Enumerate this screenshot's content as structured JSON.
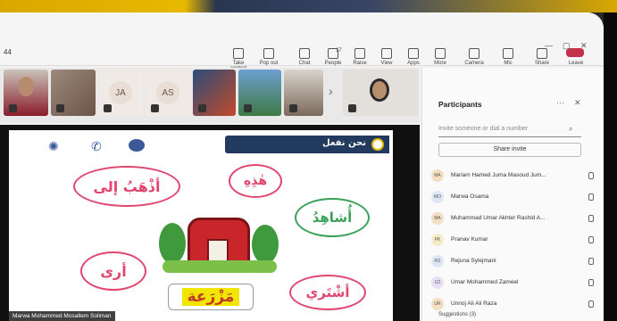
{
  "titlebar": {
    "left_text": "44",
    "buttons": [
      {
        "label": "Take control"
      },
      {
        "label": "Pop out"
      },
      {
        "label": "Chat"
      },
      {
        "label": "People",
        "count": "17"
      },
      {
        "label": "Raise"
      },
      {
        "label": "View"
      },
      {
        "label": "Apps"
      },
      {
        "label": "More"
      },
      {
        "label": "Camera"
      },
      {
        "label": "Mic"
      },
      {
        "label": "Share"
      },
      {
        "label": "Leave"
      }
    ]
  },
  "video_strip": {
    "tiles": [
      {
        "type": "video"
      },
      {
        "type": "video"
      },
      {
        "type": "initials",
        "initials": "JA"
      },
      {
        "type": "initials",
        "initials": "AS"
      },
      {
        "type": "video"
      },
      {
        "type": "video"
      },
      {
        "type": "video"
      },
      {
        "type": "video"
      }
    ],
    "next_glyph": "›"
  },
  "slide": {
    "header": "نحن نفعل",
    "words": [
      {
        "text": "أذْهَبُ إلى",
        "color": "#e0466f"
      },
      {
        "text": "هٰذِهِ",
        "color": "#e0466f"
      },
      {
        "text": "أُشاهِدُ",
        "color": "#3aa157"
      },
      {
        "text": "أرى",
        "color": "#e0466f"
      },
      {
        "text": "أشْتَري",
        "color": "#e0466f"
      },
      {
        "text": "مَزْرَعة",
        "color": "#f2e600"
      }
    ],
    "presenter": "Marwa Mohammed Mosallem Soliman"
  },
  "participants": {
    "title": "Participants",
    "invite_placeholder": "Invite someone or dial a number",
    "share_invite": "Share invite",
    "people": [
      {
        "initials": "MA",
        "name": "Mariam Hamed Juma Masoud Jum...",
        "color": "#f3dfc2"
      },
      {
        "initials": "MO",
        "name": "Marwa Osama",
        "color": "#dfe7f6"
      },
      {
        "initials": "MA",
        "name": "Muhammad Umar Akhter Rashid A...",
        "color": "#f3dfc2"
      },
      {
        "initials": "PK",
        "name": "Pranav Kumar",
        "color": "#f6ecc9"
      },
      {
        "initials": "RS",
        "name": "Rejuna Sylejmani",
        "color": "#dfe7f6"
      },
      {
        "initials": "UZ",
        "name": "Umar Mohammed Zameel",
        "color": "#e7dff6"
      },
      {
        "initials": "UR",
        "name": "Unnoj Ali Ali Raza",
        "color": "#f3dfc2"
      }
    ],
    "suggestions": "Suggestions (3)"
  }
}
